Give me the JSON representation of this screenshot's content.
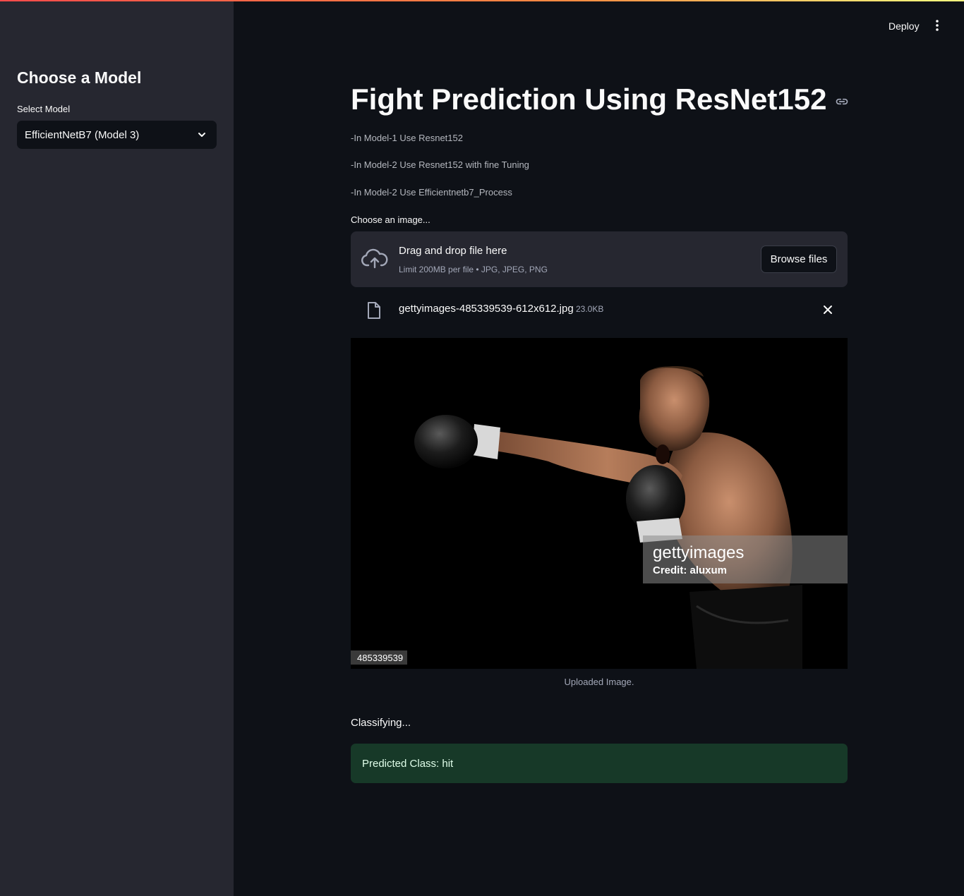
{
  "header": {
    "deploy_label": "Deploy"
  },
  "sidebar": {
    "heading": "Choose a Model",
    "select_label": "Select Model",
    "selected_model": "EfficientNetB7 (Model 3)"
  },
  "main": {
    "title": "Fight Prediction Using ResNet152",
    "notes": [
      "-In Model-1 Use Resnet152",
      "-In Model-2 Use Resnet152 with fine Tuning",
      "-In Model-2 Use Efficientnetb7_Process"
    ],
    "uploader": {
      "label": "Choose an image...",
      "dropzone_title": "Drag and drop file here",
      "dropzone_limit": "Limit 200MB per file • JPG, JPEG, PNG",
      "browse_label": "Browse files"
    },
    "file": {
      "name": "gettyimages-485339539-612x612.jpg",
      "size": "23.0KB"
    },
    "image": {
      "watermark_brand": "gettyimages",
      "watermark_credit": "Credit: aluxum",
      "image_id": "485339539",
      "caption": "Uploaded Image."
    },
    "status": "Classifying...",
    "result": "Predicted Class: hit"
  },
  "colors": {
    "background": "#0e1117",
    "sidebar": "#262730",
    "success_bg": "#173928",
    "success_text": "#dffde9"
  }
}
